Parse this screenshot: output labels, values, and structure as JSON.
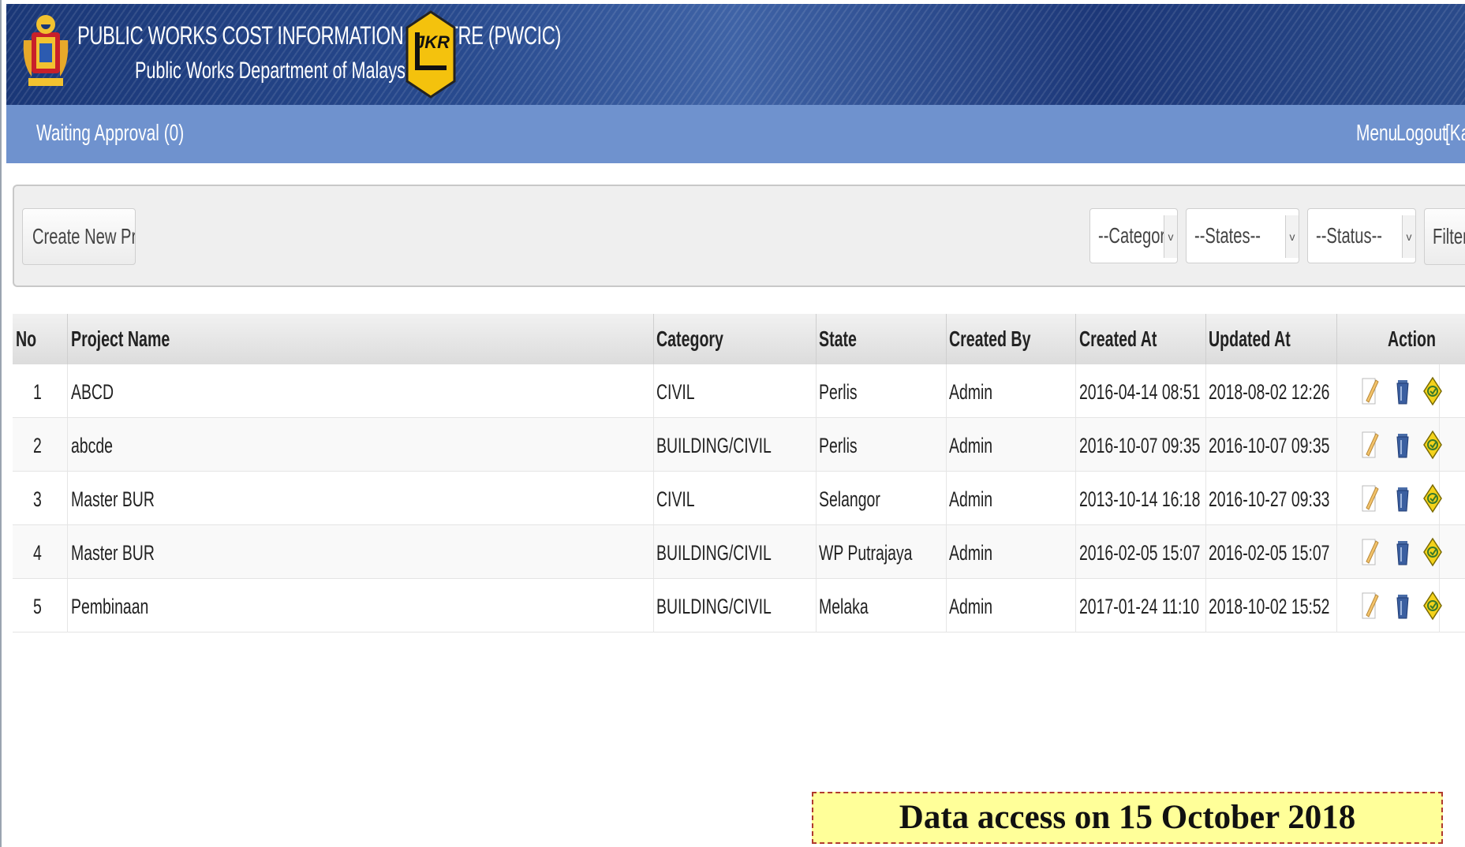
{
  "header": {
    "title": "PUBLIC WORKS COST INFORMATION CENTRE (PWCIC)",
    "subtitle": "Public Works Department of Malaysia",
    "logo_text": "JKR",
    "colors": {
      "banner": "#27498d",
      "nav": "#6f92ce"
    }
  },
  "nav": {
    "waiting_approval": "Waiting Approval (0)",
    "menu": "Menu",
    "logout": "Logout",
    "user_fragment": "[Kaz"
  },
  "toolbar": {
    "create_button": "Create New Project",
    "category_select": "--Category--",
    "states_select": "--States--",
    "status_select": "--Status--",
    "filter_button": "Filter"
  },
  "table": {
    "headers": [
      "No",
      "Project Name",
      "Category",
      "State",
      "Created By",
      "Created At",
      "Updated At",
      "Action"
    ],
    "rows": [
      {
        "no": "1",
        "name": "ABCD",
        "category": "CIVIL",
        "state": "Perlis",
        "created_by": "Admin",
        "created_at": "2016-04-14 08:51",
        "updated_at": "2018-08-02 12:26"
      },
      {
        "no": "2",
        "name": "abcde",
        "category": "BUILDING/CIVIL",
        "state": "Perlis",
        "created_by": "Admin",
        "created_at": "2016-10-07 09:35",
        "updated_at": "2016-10-07 09:35"
      },
      {
        "no": "3",
        "name": "Master BUR",
        "category": "CIVIL",
        "state": "Selangor",
        "created_by": "Admin",
        "created_at": "2013-10-14 16:18",
        "updated_at": "2016-10-27 09:33"
      },
      {
        "no": "4",
        "name": "Master BUR",
        "category": "BUILDING/CIVIL",
        "state": "WP Putrajaya",
        "created_by": "Admin",
        "created_at": "2016-02-05 15:07",
        "updated_at": "2016-02-05 15:07"
      },
      {
        "no": "5",
        "name": "Pembinaan",
        "category": "BUILDING/CIVIL",
        "state": "Melaka",
        "created_by": "Admin",
        "created_at": "2017-01-24 11:10",
        "updated_at": "2018-10-02 15:52"
      }
    ],
    "action_icons": [
      "edit-icon",
      "delete-icon",
      "submit-icon"
    ]
  },
  "note": "Data access on 15 October 2018"
}
